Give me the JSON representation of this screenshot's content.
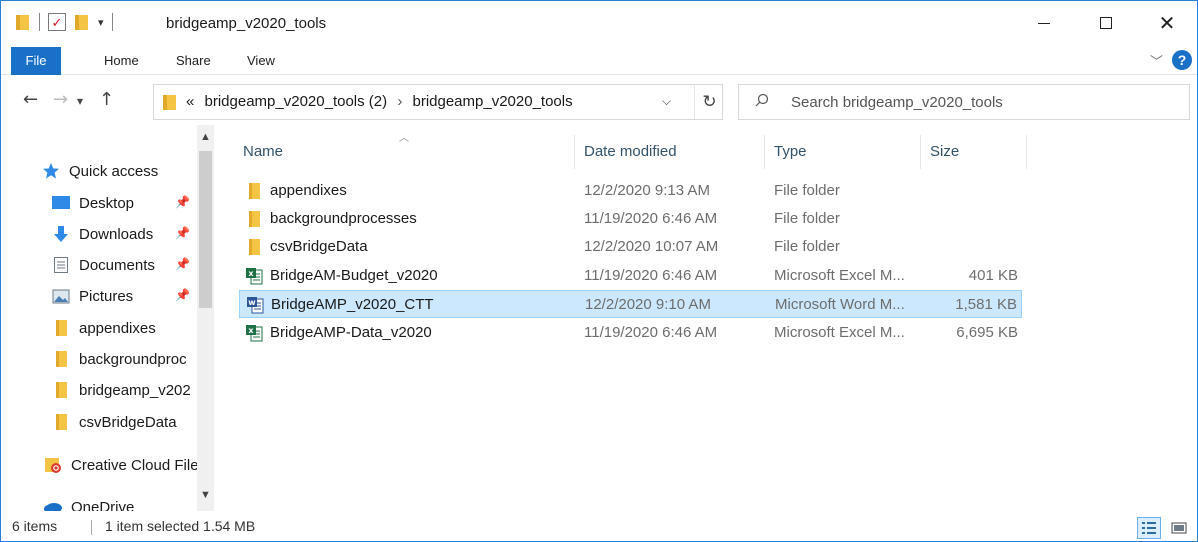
{
  "window": {
    "title": "bridgeamp_v2020_tools"
  },
  "ribbon": {
    "tabs": [
      "File",
      "Home",
      "Share",
      "View"
    ],
    "help_label": "?"
  },
  "address": {
    "overflow": "«",
    "crumbs": [
      "bridgeamp_v2020_tools (2)",
      "bridgeamp_v2020_tools"
    ]
  },
  "search": {
    "placeholder": "Search bridgeamp_v2020_tools"
  },
  "navpane": {
    "items": [
      {
        "label": "Quick access",
        "icon": "star-icon",
        "pinned": false
      },
      {
        "label": "Desktop",
        "icon": "desktop-icon",
        "pinned": true
      },
      {
        "label": "Downloads",
        "icon": "download-arrow-icon",
        "pinned": true
      },
      {
        "label": "Documents",
        "icon": "document-icon",
        "pinned": true
      },
      {
        "label": "Pictures",
        "icon": "pictures-icon",
        "pinned": true
      },
      {
        "label": "appendixes",
        "icon": "folder-icon",
        "pinned": false
      },
      {
        "label": "backgroundproc",
        "icon": "folder-icon",
        "pinned": false
      },
      {
        "label": "bridgeamp_v202",
        "icon": "folder-icon",
        "pinned": false
      },
      {
        "label": "csvBridgeData",
        "icon": "folder-icon",
        "pinned": false
      },
      {
        "label": "Creative Cloud File",
        "icon": "creative-cloud-icon",
        "pinned": false
      },
      {
        "label": "OneDrive",
        "icon": "cloud-icon",
        "pinned": false
      }
    ]
  },
  "columns": {
    "name": "Name",
    "date": "Date modified",
    "type": "Type",
    "size": "Size"
  },
  "files": [
    {
      "name": "appendixes",
      "date": "12/2/2020 9:13 AM",
      "type": "File folder",
      "size": "",
      "kind": "folder",
      "selected": false
    },
    {
      "name": "backgroundprocesses",
      "date": "11/19/2020 6:46 AM",
      "type": "File folder",
      "size": "",
      "kind": "folder",
      "selected": false
    },
    {
      "name": "csvBridgeData",
      "date": "12/2/2020 10:07 AM",
      "type": "File folder",
      "size": "",
      "kind": "folder",
      "selected": false
    },
    {
      "name": "BridgeAM-Budget_v2020",
      "date": "11/19/2020 6:46 AM",
      "type": "Microsoft Excel M...",
      "size": "401 KB",
      "kind": "excel",
      "selected": false
    },
    {
      "name": "BridgeAMP_v2020_CTT",
      "date": "12/2/2020 9:10 AM",
      "type": "Microsoft Word M...",
      "size": "1,581 KB",
      "kind": "word",
      "selected": true
    },
    {
      "name": "BridgeAMP-Data_v2020",
      "date": "11/19/2020 6:46 AM",
      "type": "Microsoft Excel M...",
      "size": "6,695 KB",
      "kind": "excel",
      "selected": false
    }
  ],
  "status": {
    "count": "6 items",
    "selection": "1 item selected  1.54 MB"
  },
  "colors": {
    "accent": "#1a6fc6",
    "folder": "#f4c544",
    "excel": "#1e7145",
    "word": "#2b579a",
    "selection": "#cce8ff"
  }
}
